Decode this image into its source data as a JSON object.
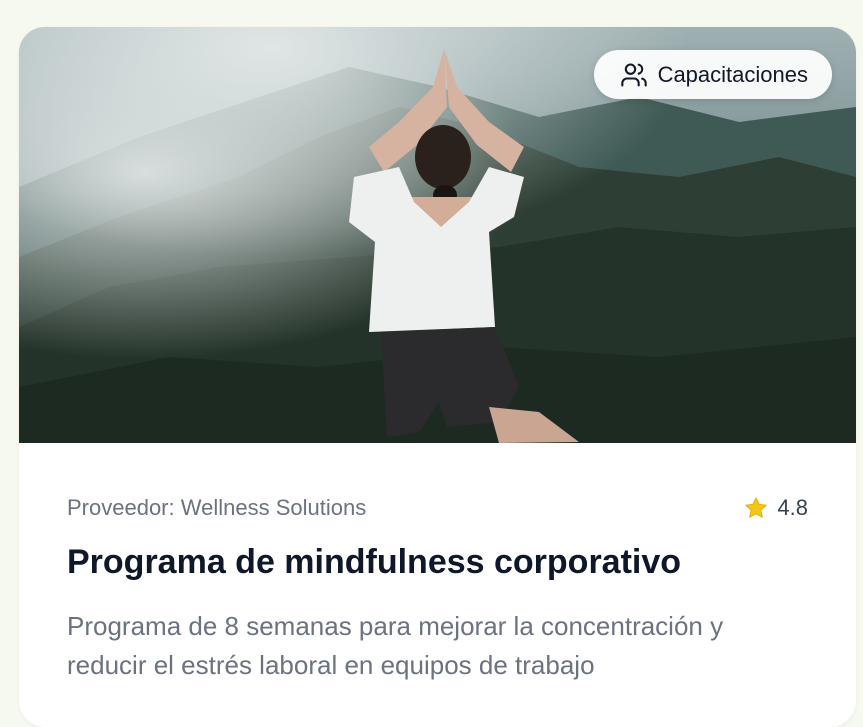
{
  "card": {
    "image": {
      "description_icon": "photo"
    },
    "badge": {
      "icon": "users-icon",
      "label": "Capacitaciones"
    },
    "provider": "Proveedor: Wellness Solutions",
    "rating": {
      "icon": "star-icon",
      "value": "4.8",
      "star_color": "#f5c518"
    },
    "title": "Programa de mindfulness corporativo",
    "description": "Programa de 8 semanas para mejorar la concentración y reducir el estrés laboral en equipos de trabajo"
  }
}
